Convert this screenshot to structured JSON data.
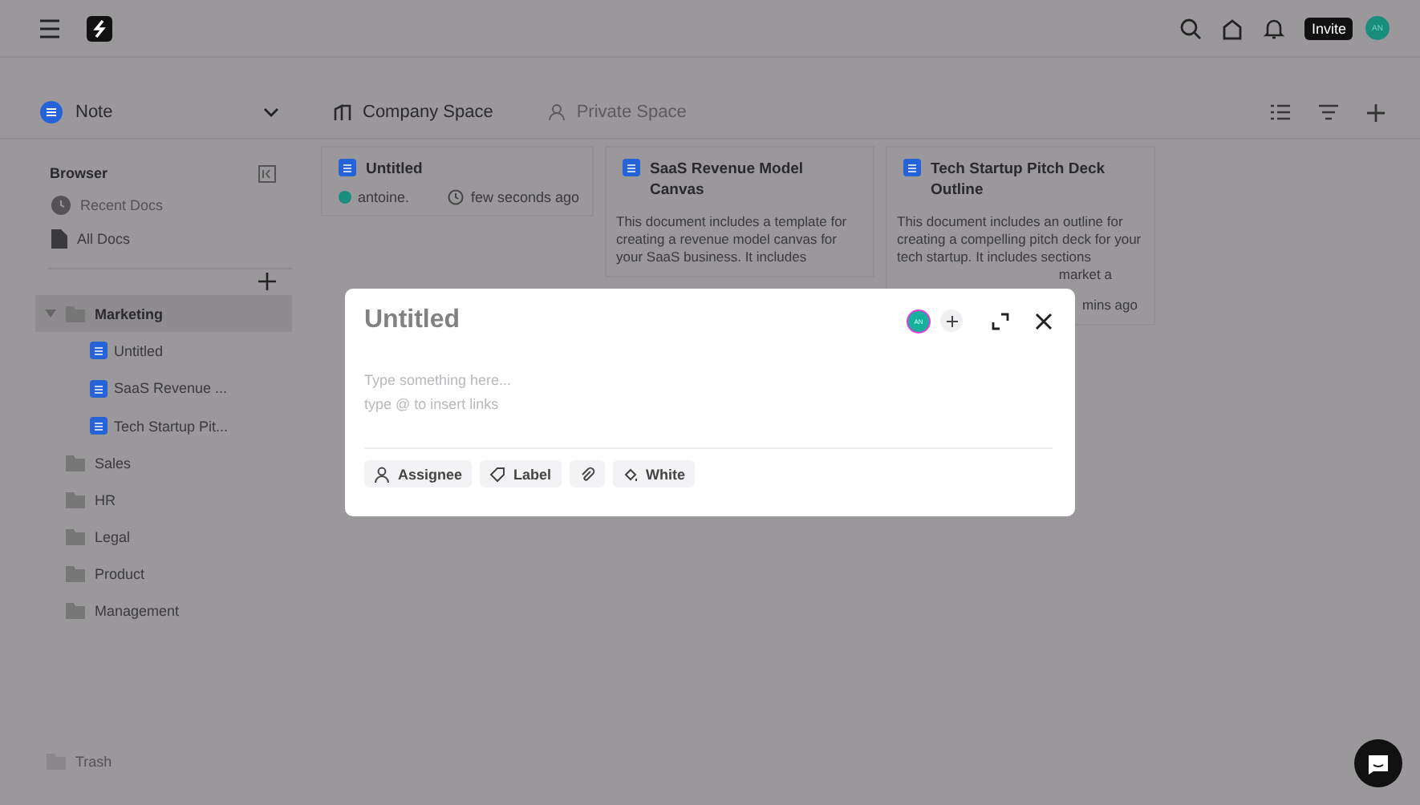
{
  "topbar": {
    "invite": "Invite",
    "avatar": "AN"
  },
  "selector": {
    "label": "Note"
  },
  "tabs": [
    {
      "label": "Company Space",
      "selected": true
    },
    {
      "label": "Private Space",
      "selected": false
    }
  ],
  "sidebar": {
    "title": "Browser",
    "nav": [
      {
        "label": "Recent Docs",
        "kind": "clock",
        "disabled": true
      },
      {
        "label": "All Docs",
        "kind": "file",
        "disabled": false
      }
    ],
    "tree": [
      {
        "label": "Marketing",
        "expanded": true,
        "selected": true,
        "children": [
          {
            "label": "Untitled"
          },
          {
            "label": "SaaS Revenue ..."
          },
          {
            "label": "Tech Startup Pit..."
          }
        ]
      },
      {
        "label": "Sales",
        "expanded": false,
        "selected": false
      },
      {
        "label": "HR",
        "expanded": false,
        "selected": false
      },
      {
        "label": "Legal",
        "expanded": false,
        "selected": false
      },
      {
        "label": "Product",
        "expanded": false,
        "selected": false
      },
      {
        "label": "Management",
        "expanded": false,
        "selected": false
      }
    ],
    "trash": "Trash"
  },
  "cards": [
    {
      "title": "Untitled",
      "author": "antoine.",
      "time": "few seconds ago"
    },
    {
      "title": "SaaS Revenue Model Canvas",
      "description": "This document includes a template for creating a revenue model canvas for your SaaS business. It includes"
    },
    {
      "title": "Tech Startup Pitch Deck Outline",
      "description": "This document includes an outline for creating a compelling pitch deck for your tech startup. It includes sections",
      "peek": "market a",
      "time": "mins ago"
    }
  ],
  "modal": {
    "title": "Untitled",
    "avatar": "AN",
    "placeholder": "Type something here...",
    "hint": "type @ to insert links",
    "actions": [
      {
        "kind": "person",
        "label": "Assignee"
      },
      {
        "kind": "tag",
        "label": "Label"
      },
      {
        "kind": "clip"
      },
      {
        "kind": "drop",
        "label": "White"
      }
    ]
  }
}
